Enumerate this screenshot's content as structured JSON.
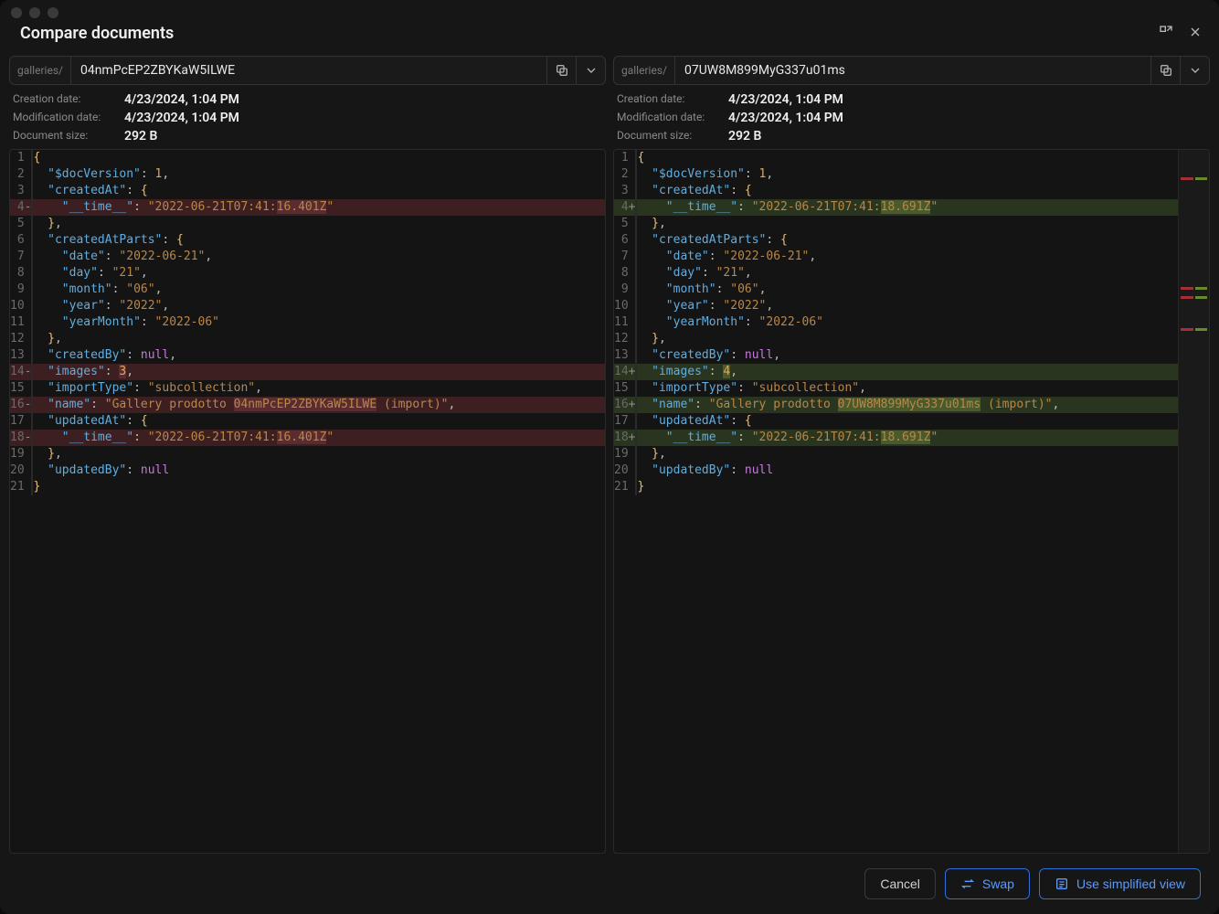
{
  "header": {
    "title": "Compare documents"
  },
  "labels": {
    "creation_date": "Creation date:",
    "modification_date": "Modification date:",
    "document_size": "Document size:"
  },
  "panes": [
    {
      "path_prefix": "galleries/",
      "doc_id": "04nmPcEP2ZBYKaW5ILWE",
      "creation_date": "4/23/2024, 1:04 PM",
      "modification_date": "4/23/2024, 1:04 PM",
      "document_size": "292 B",
      "diff_side": "del",
      "code": {
        "docVersion": 1,
        "createdAt_time_prefix": "2022-06-21T07:41:",
        "createdAt_time_diff": "16.401Z",
        "createdAtParts": {
          "date": "2022-06-21",
          "day": "21",
          "month": "06",
          "year": "2022",
          "yearMonth": "2022-06"
        },
        "images": 3,
        "importType": "subcollection",
        "name_prefix": "Gallery prodotto ",
        "name_diff": "04nmPcEP2ZBYKaW5ILWE",
        "name_suffix": " (import)",
        "updatedAt_time_prefix": "2022-06-21T07:41:",
        "updatedAt_time_diff": "16.401Z"
      }
    },
    {
      "path_prefix": "galleries/",
      "doc_id": "07UW8M899MyG337u01ms",
      "creation_date": "4/23/2024, 1:04 PM",
      "modification_date": "4/23/2024, 1:04 PM",
      "document_size": "292 B",
      "diff_side": "add",
      "code": {
        "docVersion": 1,
        "createdAt_time_prefix": "2022-06-21T07:41:",
        "createdAt_time_diff": "18.691Z",
        "createdAtParts": {
          "date": "2022-06-21",
          "day": "21",
          "month": "06",
          "year": "2022",
          "yearMonth": "2022-06"
        },
        "images": 4,
        "importType": "subcollection",
        "name_prefix": "Gallery prodotto ",
        "name_diff": "07UW8M899MyG337u01ms",
        "name_suffix": " (import)",
        "updatedAt_time_prefix": "2022-06-21T07:41:",
        "updatedAt_time_diff": "18.691Z"
      }
    }
  ],
  "footer": {
    "cancel": "Cancel",
    "swap": "Swap",
    "simplified": "Use simplified view"
  }
}
